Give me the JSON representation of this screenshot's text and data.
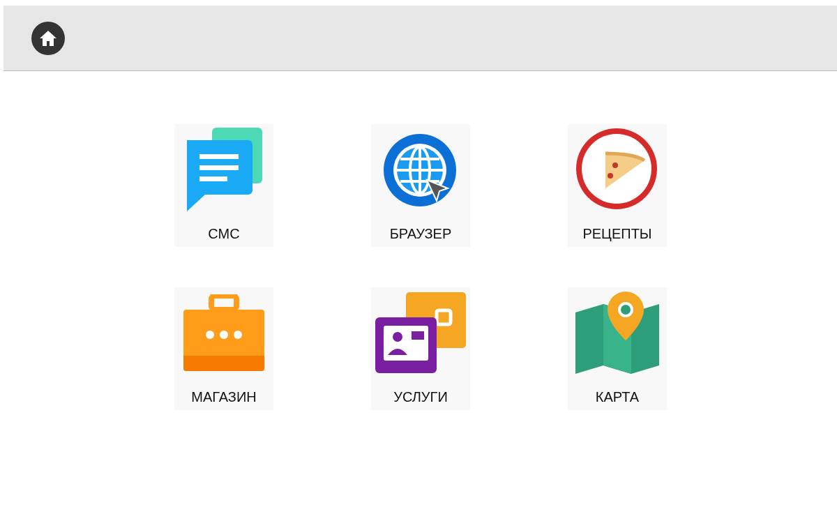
{
  "apps": [
    {
      "kind": "sms",
      "label": "СМС"
    },
    {
      "kind": "browser",
      "label": "БРАУЗЕР"
    },
    {
      "kind": "recipes",
      "label": "РЕЦЕПТЫ"
    },
    {
      "kind": "shop",
      "label": "МАГАЗИН"
    },
    {
      "kind": "services",
      "label": "УСЛУГИ"
    },
    {
      "kind": "map",
      "label": "КАРТА"
    }
  ]
}
